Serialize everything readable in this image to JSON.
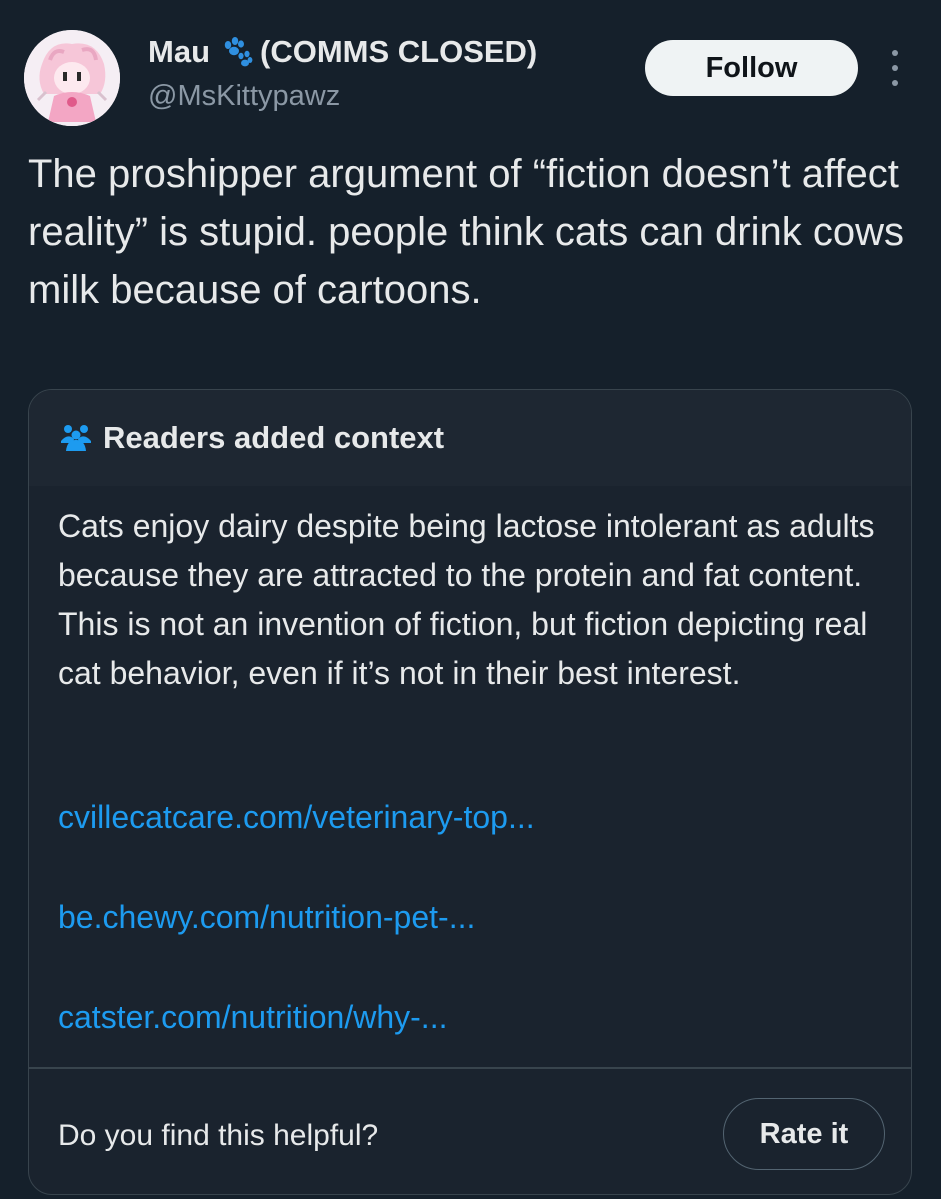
{
  "author": {
    "name": "Mau",
    "status": "(COMMS CLOSED)",
    "handle": "@MsKittypawz",
    "name_icon": "paw-print-icon",
    "avatar_icon": "avatar-image"
  },
  "follow_label": "Follow",
  "more_icon": "more-options-icon",
  "tweet": {
    "text": "The proshipper argument of “fiction doesn’t affect reality” is stupid. people think cats can drink cows milk because of cartoons."
  },
  "community_note": {
    "icon": "people-icon",
    "title": "Readers added context",
    "body": "Cats enjoy dairy despite being lactose intolerant as adults because they are attracted to the protein and fat content. This is not an invention of fiction, but fiction depicting real cat behavior, even if it’s not in their best interest.",
    "links": [
      "cvillecatcare.com/veterinary-top...",
      "be.chewy.com/nutrition-pet-...",
      "catster.com/nutrition/why-..."
    ],
    "helpful_prompt": "Do you find this helpful?",
    "rate_label": "Rate it"
  },
  "colors": {
    "background": "#15202b",
    "note_background": "#1a232e",
    "link": "#1d9bf0",
    "secondary_text": "#8b98a5",
    "paw_icon": "#2f8fe0",
    "people_icon": "#1d9bf0"
  }
}
